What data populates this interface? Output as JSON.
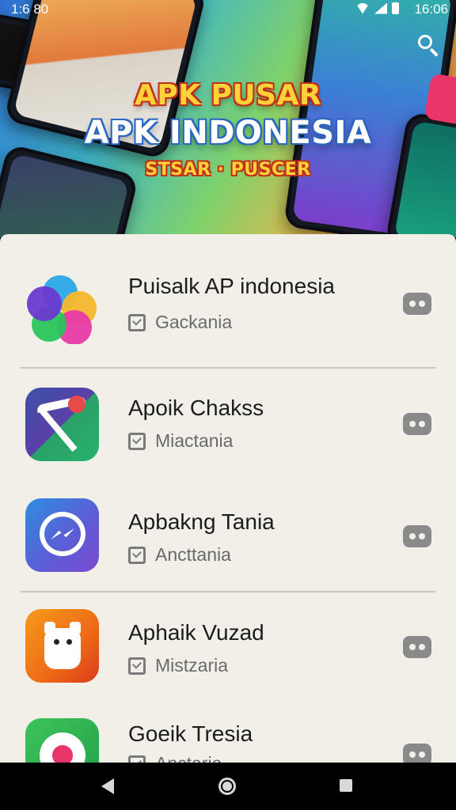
{
  "status_bar": {
    "time_left": "1:6 80",
    "time_right": "16:06"
  },
  "banner": {
    "title_line1": "APK PUSAR",
    "title_line2": "APK INDONESIA",
    "tagline": "STSAR · PUSCER"
  },
  "apps": [
    {
      "name": "Puisalk AP indonesia",
      "subtitle": "Gackania",
      "icon": "colorful-flower-icon"
    },
    {
      "name": "Apoik Chakss",
      "subtitle": "Miactania",
      "icon": "pickaxe-icon"
    },
    {
      "name": "Apbakng Tania",
      "subtitle": "Ancttania",
      "icon": "messenger-icon"
    },
    {
      "name": "Aphaik Vuzad",
      "subtitle": "Mistzaria",
      "icon": "cat-mascot-icon"
    },
    {
      "name": "Goeik Tresia",
      "subtitle": "Anctaria",
      "icon": "green-ring-icon"
    }
  ],
  "colors": {
    "panel_bg": "#f1efe8",
    "title_yellow": "#ffd23a",
    "title_red_outline": "#c2301a",
    "title_blue_outline": "#2a65c2"
  }
}
